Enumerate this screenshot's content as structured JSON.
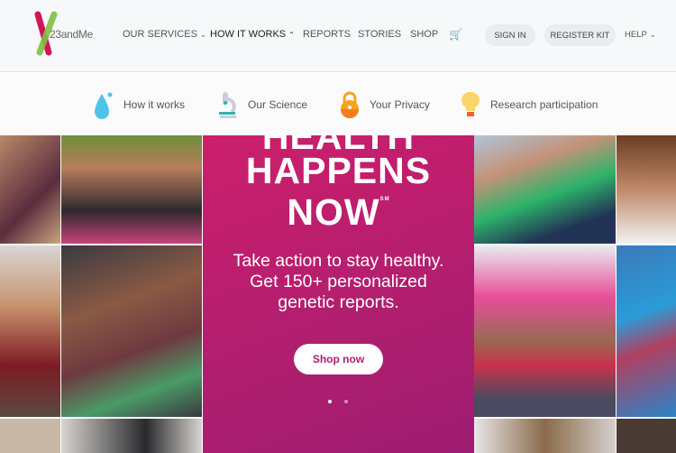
{
  "header": {
    "logo_text": "23andMe",
    "nav": [
      {
        "label": "OUR SERVICES",
        "chevron": "down"
      },
      {
        "label": "HOW IT WORKS",
        "chevron": "up",
        "active": true
      },
      {
        "label": "REPORTS"
      },
      {
        "label": "STORIES"
      },
      {
        "label": "SHOP"
      }
    ],
    "cart_icon": "cart-icon",
    "sign_in": "SIGN IN",
    "register_kit": "REGISTER KIT",
    "help": "HELP"
  },
  "subnav": [
    {
      "label": "How it works",
      "icon": "water-drop-icon"
    },
    {
      "label": "Our Science",
      "icon": "microscope-icon"
    },
    {
      "label": "Your Privacy",
      "icon": "lock-icon"
    },
    {
      "label": "Research participation",
      "icon": "lightbulb-icon"
    }
  ],
  "hero": {
    "line1": "HEALTH",
    "line2": "HAPPENS",
    "line3": "NOW",
    "service_mark": "SM",
    "tagline1": "Take action to stay healthy.",
    "tagline2": "Get 150+ personalized",
    "tagline3": "genetic reports.",
    "cta": "Shop now",
    "slides": 2,
    "active_slide": 1
  },
  "colors": {
    "brand_pink": "#c51f6e",
    "brand_green": "#7dc242"
  }
}
